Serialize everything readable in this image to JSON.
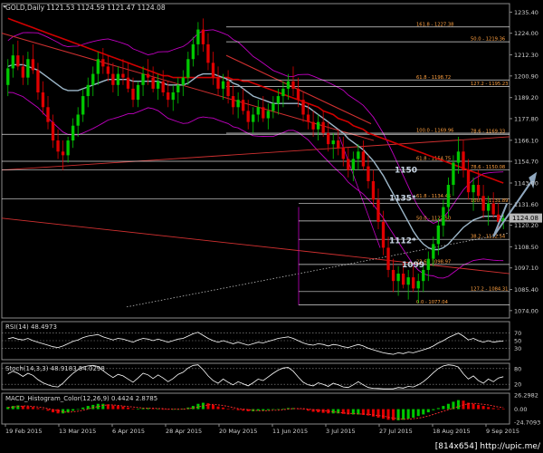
{
  "window": {
    "symbol_title": "GOLD,Daily  1121.53 1124.59 1121.47 1124.08",
    "watermark": "[814x654]  http://upic.me/"
  },
  "colors": {
    "background": "#000000",
    "frame": "#8a8a8a",
    "grid": "#2a2a2a",
    "bull": "#00c800",
    "bear": "#e00000",
    "ma_fast": "#9db7c9",
    "ma_mid": "#d00000",
    "bollinger": "#c000c0",
    "fib_line": "#ffffff",
    "fib_label": "#ffa040",
    "trend_red": "#d03030",
    "trend_dotted": "#bbbbbb",
    "forecast": "#90a8bf",
    "rsi_line": "#ffffff",
    "stoch_line": "#ffffff",
    "macd_up": "#00c800",
    "macd_down": "#e00000",
    "macd_signal": "#ff3030",
    "price_box": "#b8b8b8"
  },
  "chart_data": [
    {
      "type": "candlestick",
      "title": "GOLD,Daily  1121.53 1124.59 1121.47 1124.08",
      "ylim": [
        1070.0,
        1240.0
      ],
      "y_ticks": [
        "1235.40",
        "1224.00",
        "1212.30",
        "1200.90",
        "1189.20",
        "1177.80",
        "1166.10",
        "1154.70",
        "1143.00",
        "1131.60",
        "1120.20",
        "1108.50",
        "1097.10",
        "1085.40",
        "1074.00"
      ],
      "x_ticks": [
        "19 Feb 2015",
        "13 Mar 2015",
        "6 Apr 2015",
        "28 Apr 2015",
        "20 May 2015",
        "11 Jun 2015",
        "3 Jul 2015",
        "27 Jul 2015",
        "18 Aug 2015",
        "9 Sep 2015"
      ],
      "current_price": "1124.08",
      "fib_levels": [
        {
          "price": 1227.38,
          "label": "161.8 - 1227.38"
        },
        {
          "price": 1219.36,
          "label": "50.0 - 1219.36"
        },
        {
          "price": 1198.72,
          "label": "61.8 - 1198.72"
        },
        {
          "price": 1195.23,
          "label": "127.2 - 1195.23"
        },
        {
          "price": 1169.96,
          "label": "100.0 - 1169.96"
        },
        {
          "price": 1169.33,
          "label": "78.6 - 1169.33"
        },
        {
          "price": 1154.75,
          "label": "61.8 - 1154.75"
        },
        {
          "price": 1150.08,
          "label": "78.6 - 1150.08"
        },
        {
          "price": 1134.46,
          "label": "61.8 - 1134.46"
        },
        {
          "price": 1131.89,
          "label": "100.0 - 1131.89"
        },
        {
          "price": 1122.5,
          "label": "50.0 - 1122.50"
        },
        {
          "price": 1112.54,
          "label": "38.2 - 1112.54"
        },
        {
          "price": 1098.97,
          "label": "23.6 - 1098.97"
        },
        {
          "price": 1084.31,
          "label": "127.2 - 1084.31"
        },
        {
          "price": 1077.04,
          "label": "0.0 - 1077.04"
        }
      ],
      "annotations": [
        {
          "text": "1150",
          "price": 1150
        },
        {
          "text": "1135*",
          "price": 1135
        },
        {
          "text": "1112*",
          "price": 1112
        },
        {
          "text": "1099",
          "price": 1099
        }
      ],
      "candles": [
        [
          1196,
          1210,
          1190,
          1205
        ],
        [
          1205,
          1218,
          1200,
          1212
        ],
        [
          1212,
          1220,
          1204,
          1206
        ],
        [
          1206,
          1212,
          1196,
          1200
        ],
        [
          1200,
          1214,
          1196,
          1210
        ],
        [
          1210,
          1218,
          1202,
          1204
        ],
        [
          1204,
          1208,
          1188,
          1192
        ],
        [
          1192,
          1198,
          1180,
          1184
        ],
        [
          1184,
          1190,
          1172,
          1176
        ],
        [
          1176,
          1180,
          1162,
          1166
        ],
        [
          1166,
          1172,
          1156,
          1160
        ],
        [
          1160,
          1166,
          1150,
          1158
        ],
        [
          1158,
          1168,
          1154,
          1166
        ],
        [
          1166,
          1178,
          1162,
          1174
        ],
        [
          1174,
          1184,
          1168,
          1180
        ],
        [
          1180,
          1194,
          1176,
          1190
        ],
        [
          1190,
          1200,
          1184,
          1196
        ],
        [
          1196,
          1206,
          1190,
          1202
        ],
        [
          1202,
          1214,
          1196,
          1210
        ],
        [
          1210,
          1216,
          1202,
          1206
        ],
        [
          1206,
          1212,
          1198,
          1202
        ],
        [
          1202,
          1208,
          1192,
          1196
        ],
        [
          1196,
          1206,
          1190,
          1202
        ],
        [
          1202,
          1210,
          1196,
          1200
        ],
        [
          1200,
          1208,
          1192,
          1194
        ],
        [
          1194,
          1200,
          1184,
          1188
        ],
        [
          1188,
          1198,
          1184,
          1196
        ],
        [
          1196,
          1206,
          1190,
          1202
        ],
        [
          1202,
          1210,
          1196,
          1200
        ],
        [
          1200,
          1206,
          1192,
          1194
        ],
        [
          1194,
          1202,
          1188,
          1198
        ],
        [
          1198,
          1204,
          1190,
          1192
        ],
        [
          1192,
          1198,
          1184,
          1188
        ],
        [
          1188,
          1196,
          1182,
          1192
        ],
        [
          1192,
          1200,
          1186,
          1196
        ],
        [
          1196,
          1204,
          1190,
          1200
        ],
        [
          1200,
          1214,
          1196,
          1210
        ],
        [
          1210,
          1222,
          1206,
          1218
        ],
        [
          1218,
          1230,
          1212,
          1226
        ],
        [
          1226,
          1232,
          1214,
          1218
        ],
        [
          1218,
          1224,
          1204,
          1208
        ],
        [
          1208,
          1214,
          1196,
          1200
        ],
        [
          1200,
          1206,
          1190,
          1194
        ],
        [
          1194,
          1202,
          1188,
          1198
        ],
        [
          1198,
          1204,
          1186,
          1190
        ],
        [
          1190,
          1196,
          1180,
          1184
        ],
        [
          1184,
          1192,
          1178,
          1188
        ],
        [
          1188,
          1194,
          1180,
          1182
        ],
        [
          1182,
          1188,
          1172,
          1176
        ],
        [
          1176,
          1184,
          1170,
          1180
        ],
        [
          1180,
          1188,
          1176,
          1184
        ],
        [
          1184,
          1190,
          1176,
          1178
        ],
        [
          1178,
          1186,
          1172,
          1182
        ],
        [
          1182,
          1190,
          1178,
          1186
        ],
        [
          1186,
          1194,
          1180,
          1190
        ],
        [
          1190,
          1198,
          1184,
          1194
        ],
        [
          1194,
          1202,
          1188,
          1198
        ],
        [
          1198,
          1206,
          1190,
          1194
        ],
        [
          1194,
          1200,
          1184,
          1188
        ],
        [
          1188,
          1192,
          1176,
          1180
        ],
        [
          1180,
          1186,
          1172,
          1176
        ],
        [
          1176,
          1182,
          1168,
          1172
        ],
        [
          1172,
          1180,
          1166,
          1176
        ],
        [
          1176,
          1182,
          1168,
          1170
        ],
        [
          1170,
          1176,
          1160,
          1164
        ],
        [
          1164,
          1170,
          1156,
          1166
        ],
        [
          1166,
          1172,
          1158,
          1162
        ],
        [
          1162,
          1168,
          1152,
          1156
        ],
        [
          1156,
          1162,
          1146,
          1150
        ],
        [
          1150,
          1160,
          1144,
          1156
        ],
        [
          1156,
          1164,
          1150,
          1160
        ],
        [
          1160,
          1166,
          1150,
          1152
        ],
        [
          1152,
          1158,
          1140,
          1144
        ],
        [
          1144,
          1150,
          1130,
          1134
        ],
        [
          1134,
          1140,
          1118,
          1122
        ],
        [
          1122,
          1128,
          1104,
          1108
        ],
        [
          1108,
          1114,
          1092,
          1096
        ],
        [
          1096,
          1102,
          1084,
          1090
        ],
        [
          1090,
          1098,
          1082,
          1094
        ],
        [
          1094,
          1100,
          1086,
          1088
        ],
        [
          1088,
          1096,
          1080,
          1092
        ],
        [
          1092,
          1098,
          1084,
          1086
        ],
        [
          1086,
          1094,
          1078,
          1090
        ],
        [
          1090,
          1100,
          1084,
          1096
        ],
        [
          1096,
          1106,
          1090,
          1102
        ],
        [
          1102,
          1114,
          1098,
          1110
        ],
        [
          1110,
          1124,
          1104,
          1120
        ],
        [
          1120,
          1134,
          1114,
          1130
        ],
        [
          1130,
          1146,
          1124,
          1142
        ],
        [
          1142,
          1158,
          1136,
          1154
        ],
        [
          1154,
          1168,
          1148,
          1160
        ],
        [
          1160,
          1166,
          1146,
          1150
        ],
        [
          1150,
          1156,
          1134,
          1138
        ],
        [
          1138,
          1146,
          1128,
          1142
        ],
        [
          1142,
          1150,
          1134,
          1136
        ],
        [
          1136,
          1142,
          1124,
          1128
        ],
        [
          1128,
          1136,
          1120,
          1132
        ],
        [
          1132,
          1138,
          1124,
          1126
        ],
        [
          1126,
          1132,
          1118,
          1122
        ],
        [
          1122,
          1126,
          1118,
          1124
        ]
      ],
      "ma_fast": [
        1206,
        1207,
        1207,
        1207,
        1206,
        1205,
        1204,
        1202,
        1200,
        1198,
        1196,
        1194,
        1193,
        1193,
        1193,
        1194,
        1195,
        1196,
        1197,
        1198,
        1199,
        1199,
        1199,
        1199,
        1199,
        1198,
        1198,
        1198,
        1198,
        1198,
        1198,
        1197,
        1196,
        1196,
        1196,
        1196,
        1197,
        1199,
        1201,
        1202,
        1202,
        1202,
        1201,
        1200,
        1199,
        1197,
        1196,
        1194,
        1192,
        1190,
        1189,
        1188,
        1187,
        1186,
        1186,
        1186,
        1186,
        1186,
        1186,
        1185,
        1184,
        1182,
        1180,
        1178,
        1176,
        1174,
        1172,
        1170,
        1167,
        1165,
        1163,
        1161,
        1158,
        1155,
        1151,
        1147,
        1142,
        1137,
        1132,
        1127,
        1122,
        1117,
        1113,
        1110,
        1108,
        1107,
        1107,
        1108,
        1110,
        1113,
        1116,
        1119,
        1121,
        1123,
        1124,
        1125,
        1125,
        1125,
        1125,
        1125
      ],
      "ma_slow": [
        1232,
        1231,
        1230,
        1229,
        1228,
        1227,
        1226,
        1225,
        1224,
        1223,
        1222,
        1221,
        1220,
        1219,
        1218,
        1217,
        1216,
        1215,
        1214,
        1213,
        1212,
        1211,
        1210,
        1209,
        1208,
        1207,
        1206,
        1205,
        1204,
        1203,
        1202,
        1201,
        1201,
        1200,
        1200,
        1200,
        1200,
        1200,
        1200,
        1200,
        1200,
        1200,
        1200,
        1200,
        1200,
        1199,
        1199,
        1198,
        1198,
        1197,
        1196,
        1195,
        1194,
        1193,
        1192,
        1191,
        1190,
        1189,
        1188,
        1187,
        1186,
        1185,
        1184,
        1182,
        1181,
        1180,
        1178,
        1177,
        1176,
        1174,
        1173,
        1172,
        1170,
        1169,
        1168,
        1167,
        1166,
        1165,
        1164,
        1163,
        1162,
        1161,
        1160,
        1159,
        1158,
        1157,
        1156,
        1155,
        1154,
        1153,
        1152,
        1151,
        1150,
        1149,
        1148,
        1147,
        1146,
        1145,
        1144,
        1143
      ]
    },
    {
      "type": "line",
      "title": "RSI(14) 48.4973",
      "ylim": [
        0,
        100
      ],
      "y_ticks": [
        "70",
        "50",
        "30"
      ],
      "values": [
        55,
        58,
        54,
        52,
        56,
        50,
        46,
        42,
        38,
        34,
        32,
        36,
        42,
        48,
        52,
        58,
        62,
        64,
        66,
        60,
        56,
        52,
        56,
        54,
        50,
        46,
        52,
        56,
        54,
        50,
        54,
        50,
        46,
        50,
        54,
        56,
        62,
        68,
        72,
        64,
        56,
        50,
        46,
        50,
        46,
        42,
        46,
        42,
        38,
        42,
        46,
        44,
        48,
        52,
        56,
        58,
        60,
        56,
        50,
        44,
        40,
        38,
        42,
        40,
        36,
        40,
        38,
        34,
        32,
        36,
        40,
        36,
        30,
        26,
        22,
        18,
        16,
        14,
        18,
        16,
        20,
        18,
        22,
        26,
        30,
        36,
        44,
        50,
        58,
        64,
        70,
        62,
        52,
        56,
        50,
        46,
        50,
        46,
        48,
        48.5
      ]
    },
    {
      "type": "line",
      "title": "Stoch(14,3,3) 48.9183 54.0298",
      "ylim": [
        0,
        100
      ],
      "y_ticks": [
        "80",
        "20"
      ],
      "values": [
        60,
        70,
        62,
        50,
        62,
        54,
        38,
        26,
        18,
        12,
        10,
        24,
        44,
        62,
        76,
        86,
        90,
        92,
        88,
        72,
        58,
        46,
        58,
        52,
        40,
        28,
        44,
        62,
        56,
        42,
        56,
        44,
        30,
        42,
        58,
        66,
        82,
        92,
        94,
        76,
        52,
        34,
        24,
        40,
        28,
        18,
        30,
        22,
        14,
        26,
        40,
        34,
        48,
        62,
        74,
        82,
        84,
        70,
        48,
        28,
        18,
        14,
        26,
        20,
        12,
        24,
        18,
        10,
        8,
        18,
        30,
        18,
        8,
        5,
        4,
        3,
        3,
        3,
        8,
        6,
        12,
        10,
        18,
        30,
        46,
        64,
        80,
        90,
        94,
        92,
        86,
        60,
        40,
        52,
        34,
        24,
        40,
        30,
        44,
        49
      ]
    },
    {
      "type": "bar",
      "title": "MACD_Histogram_Color(12,26,9) 0.4424 2.8785",
      "ylim": [
        -28,
        30
      ],
      "y_ticks": [
        "26.2982",
        "0.00",
        "-24.7093"
      ],
      "values": [
        4,
        6,
        7,
        6,
        5,
        4,
        2,
        0,
        -3,
        -6,
        -8,
        -8,
        -6,
        -3,
        0,
        3,
        6,
        8,
        10,
        10,
        9,
        7,
        6,
        5,
        3,
        1,
        1,
        2,
        2,
        1,
        1,
        0,
        -1,
        -1,
        0,
        1,
        3,
        6,
        10,
        12,
        11,
        8,
        5,
        3,
        1,
        -1,
        -2,
        -3,
        -4,
        -4,
        -3,
        -3,
        -2,
        -1,
        0,
        1,
        2,
        2,
        1,
        -1,
        -3,
        -5,
        -6,
        -7,
        -8,
        -8,
        -8,
        -9,
        -10,
        -10,
        -10,
        -11,
        -12,
        -14,
        -16,
        -18,
        -20,
        -21,
        -21,
        -20,
        -18,
        -16,
        -13,
        -10,
        -6,
        -2,
        2,
        6,
        10,
        14,
        17,
        16,
        12,
        10,
        8,
        6,
        4,
        2,
        1,
        0.4
      ],
      "signal": [
        3,
        4,
        5,
        6,
        6,
        5,
        4,
        3,
        1,
        -1,
        -3,
        -5,
        -6,
        -5,
        -4,
        -2,
        0,
        3,
        5,
        7,
        8,
        8,
        7,
        6,
        5,
        4,
        3,
        2,
        2,
        2,
        1,
        1,
        0,
        0,
        0,
        0,
        1,
        2,
        4,
        6,
        8,
        9,
        8,
        7,
        5,
        3,
        1,
        0,
        -1,
        -2,
        -3,
        -3,
        -3,
        -2,
        -2,
        -1,
        0,
        1,
        1,
        1,
        0,
        -1,
        -2,
        -3,
        -4,
        -5,
        -6,
        -7,
        -8,
        -8,
        -9,
        -9,
        -10,
        -11,
        -12,
        -13,
        -15,
        -17,
        -18,
        -19,
        -19,
        -18,
        -17,
        -15,
        -13,
        -10,
        -7,
        -4,
        -1,
        2,
        5,
        8,
        10,
        11,
        10,
        9,
        8,
        6,
        4,
        3
      ]
    }
  ]
}
